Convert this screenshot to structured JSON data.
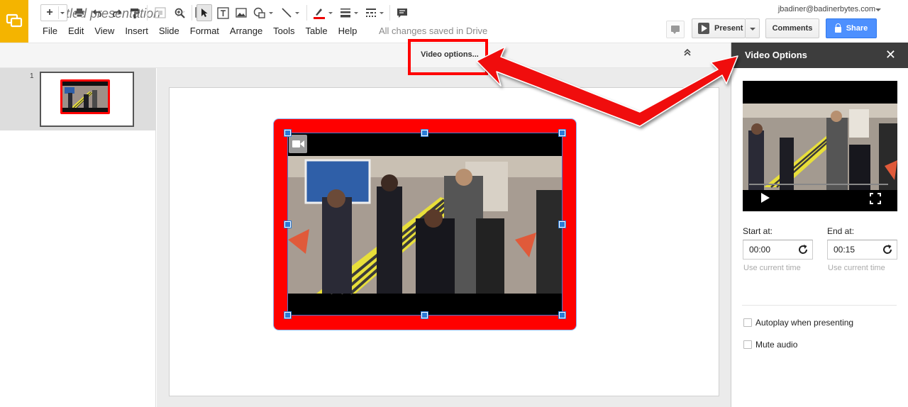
{
  "header": {
    "doc_title": "Untitled presentation",
    "save_status": "All changes saved in Drive",
    "user_email": "jbadiner@badinerbytes.com",
    "menu": [
      "File",
      "Edit",
      "View",
      "Insert",
      "Slide",
      "Format",
      "Arrange",
      "Tools",
      "Table",
      "Help"
    ],
    "present_label": "Present",
    "comments_label": "Comments",
    "share_label": "Share"
  },
  "toolbar": {
    "add_label": "+",
    "video_options_label": "Video options...",
    "icons": [
      "print-icon",
      "undo-icon",
      "redo-icon",
      "paint-format-icon",
      "zoom-fit-icon",
      "zoom-icon",
      "select-icon",
      "text-box-icon",
      "image-icon",
      "shape-icon",
      "line-icon",
      "line-color-icon",
      "line-weight-icon",
      "line-dash-icon",
      "speaker-notes-icon",
      "collapse-icon"
    ]
  },
  "filmstrip": {
    "slides": [
      {
        "number": "1"
      }
    ]
  },
  "panel": {
    "title": "Video Options",
    "close_label": "✕",
    "start_label": "Start at:",
    "start_value": "00:00",
    "end_label": "End at:",
    "end_value": "00:15",
    "use_current_label": "Use current time",
    "autoplay_label": "Autoplay when presenting",
    "mute_label": "Mute audio",
    "autoplay_checked": false,
    "mute_checked": false
  },
  "colors": {
    "logo": "#f4b400",
    "share": "#4d90fe",
    "highlight": "#ff0000",
    "selection": "#2b7bd6",
    "panel_header": "#3d3d3d"
  }
}
